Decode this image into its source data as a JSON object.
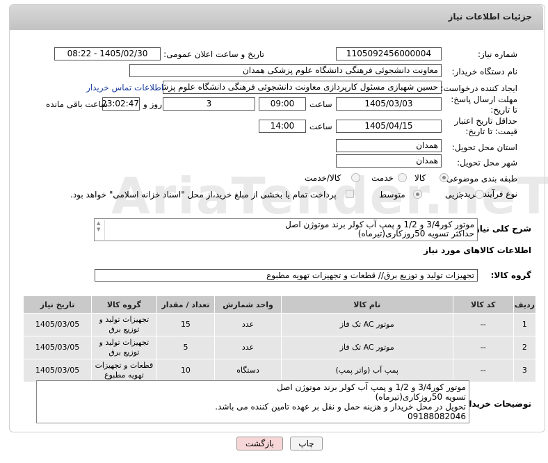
{
  "header": {
    "title": "جزئیات اطلاعات نیاز"
  },
  "form": {
    "need_number_label": "شماره نیاز:",
    "need_number": "1105092456000004",
    "announce_label": "تاریخ و ساعت اعلان عمومی:",
    "announce_value": "1405/02/30 - 08:22",
    "buyer_org_label": "نام دستگاه خریدار:",
    "buyer_org": "معاونت دانشجوئی فرهنگی دانشگاه علوم پزشکی همدان",
    "requester_label": "ایجاد کننده درخواست:",
    "requester": "حسین شهبازی مسئول کارپردازی معاونت دانشجوئی فرهنگی دانشگاه علوم پزشکی همدان",
    "contact_link": "اطلاعات تماس خریدار",
    "deadline_label": "مهلت ارسال پاسخ: تا تاریخ:",
    "deadline_date": "1405/03/03",
    "time_label": "ساعت",
    "deadline_time": "09:00",
    "days_value": "3",
    "days_label": "روز و",
    "remaining_time": "23:02:47",
    "remaining_label": "ساعت باقی مانده",
    "validity_label": "حداقل تاریخ اعتبار قیمت: تا تاریخ:",
    "validity_date": "1405/04/15",
    "validity_time": "14:00",
    "province_label": "استان محل تحویل:",
    "province": "همدان",
    "city_label": "شهر محل تحویل:",
    "city": "همدان",
    "category_label": "طبقه بندی موضوعی:",
    "category_options": [
      "کالا",
      "خدمت",
      "کالا/خدمت"
    ],
    "category_selected": "کالا",
    "process_label": "نوع فرآیند خرید :",
    "process_options": [
      "جزیی",
      "متوسط"
    ],
    "process_selected": "متوسط",
    "payment_note": "پرداخت تمام یا بخشی از مبلغ خرید،از محل \"اسناد خزانه اسلامی\" خواهد بود."
  },
  "description": {
    "label": "شرح کلی نیاز:",
    "text": "موتور کور3/4 و 1/2 و پمپ آب کولر برند موتوژن اصل\nحداکثر تسویه 50روزکاری(تیرماه)"
  },
  "goods": {
    "section_title": "اطلاعات کالاهای مورد نیاز",
    "group_label": "گروه کالا:",
    "group_value": "تجهیزات تولید و توزیع برق//  قطعات و تجهیزات تهویه مطبوع",
    "columns": [
      "ردیف",
      "کد کالا",
      "نام کالا",
      "واحد شمارش",
      "تعداد / مقدار",
      "گروه کالا",
      "تاریخ نیاز"
    ],
    "rows": [
      {
        "row": "1",
        "code": "--",
        "name": "موتور AC تک فاز",
        "unit": "عدد",
        "qty": "15",
        "group": "تجهیزات تولید و توزیع برق",
        "date": "1405/03/05"
      },
      {
        "row": "2",
        "code": "--",
        "name": "موتور AC تک فاز",
        "unit": "عدد",
        "qty": "5",
        "group": "تجهیزات تولید و توزیع برق",
        "date": "1405/03/05"
      },
      {
        "row": "3",
        "code": "--",
        "name": "پمپ آب (واتر پمپ)",
        "unit": "دستگاه",
        "qty": "10",
        "group": "قطعات و تجهیزات تهویه مطبوع",
        "date": "1405/03/05"
      }
    ]
  },
  "buyer_notes": {
    "label": "توضیحات خریدار:",
    "text": "موتور کور3/4 و 1/2 و پمپ آب کولر برند موتوژن اصل\nتسویه 50روزکاری(تیرماه)\nتحویل در محل خریدار و هزینه حمل و نقل بر عهده تامین کننده می باشد.\n09188082046"
  },
  "buttons": {
    "print": "چاپ",
    "back": "بازگشت"
  },
  "watermark": "AriaTender.neT",
  "colors": {
    "header_bg": "#c8c8c8",
    "link": "#1a3d9c",
    "back_button": "#f6d6d6",
    "table_head": "#c9c9c9",
    "table_cell": "#e6e6e6"
  }
}
